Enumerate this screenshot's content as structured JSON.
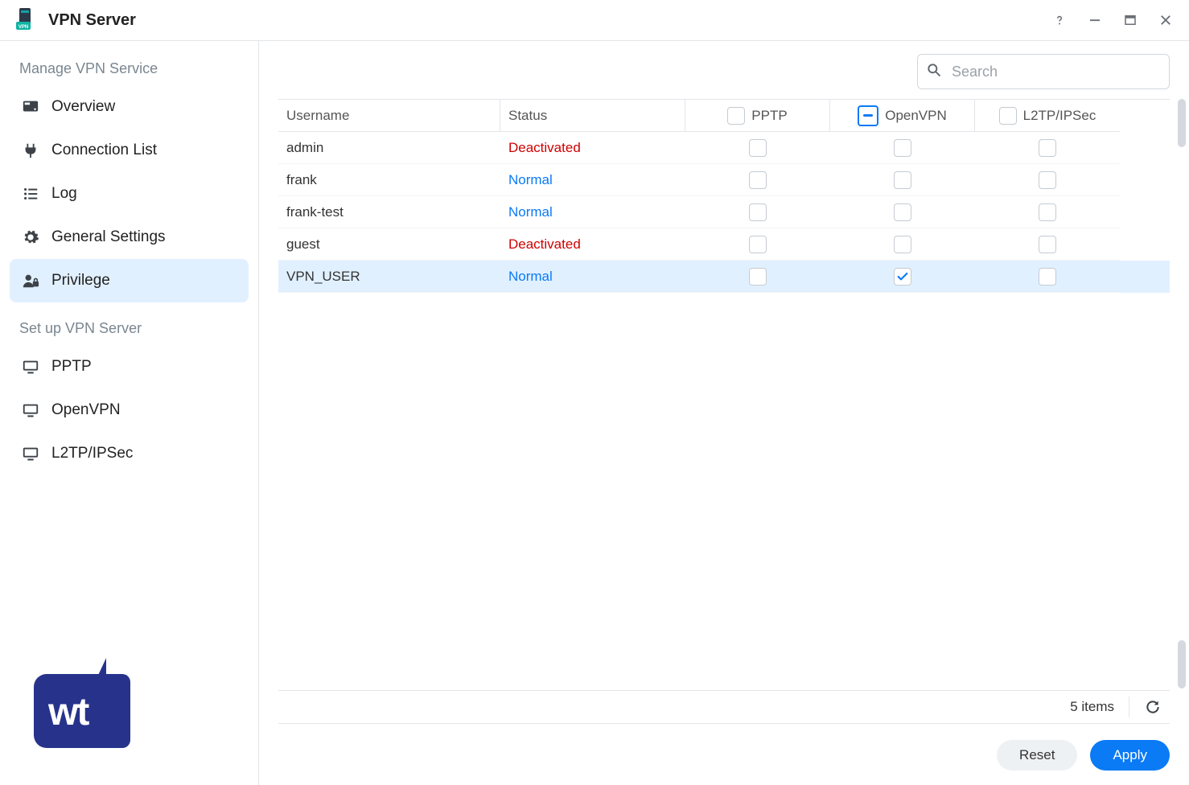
{
  "window": {
    "title": "VPN Server"
  },
  "sidebar": {
    "section1": "Manage VPN Service",
    "section2": "Set up VPN Server",
    "items1": [
      {
        "label": "Overview"
      },
      {
        "label": "Connection List"
      },
      {
        "label": "Log"
      },
      {
        "label": "General Settings"
      },
      {
        "label": "Privilege"
      }
    ],
    "items2": [
      {
        "label": "PPTP"
      },
      {
        "label": "OpenVPN"
      },
      {
        "label": "L2TP/IPSec"
      }
    ],
    "active": "Privilege"
  },
  "search": {
    "placeholder": "Search"
  },
  "columns": {
    "username": "Username",
    "status": "Status",
    "pptp": "PPTP",
    "openvpn": "OpenVPN",
    "l2tp": "L2TP/IPSec"
  },
  "header_checks": {
    "pptp": "unchecked",
    "openvpn": "indeterminate",
    "l2tp": "unchecked"
  },
  "rows": [
    {
      "username": "admin",
      "status": "Deactivated",
      "status_class": "deactivated",
      "pptp": false,
      "openvpn": false,
      "l2tp": false,
      "selected": false
    },
    {
      "username": "frank",
      "status": "Normal",
      "status_class": "normal",
      "pptp": false,
      "openvpn": false,
      "l2tp": false,
      "selected": false
    },
    {
      "username": "frank-test",
      "status": "Normal",
      "status_class": "normal",
      "pptp": false,
      "openvpn": false,
      "l2tp": false,
      "selected": false
    },
    {
      "username": "guest",
      "status": "Deactivated",
      "status_class": "deactivated",
      "pptp": false,
      "openvpn": false,
      "l2tp": false,
      "selected": false
    },
    {
      "username": "VPN_USER",
      "status": "Normal",
      "status_class": "normal",
      "pptp": false,
      "openvpn": true,
      "l2tp": false,
      "selected": true
    }
  ],
  "footer": {
    "count_label": "5 items"
  },
  "buttons": {
    "reset": "Reset",
    "apply": "Apply"
  }
}
